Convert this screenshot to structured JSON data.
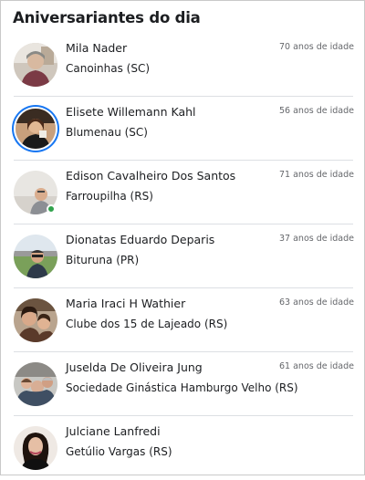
{
  "title": "Aniversariantes do dia",
  "colors": {
    "accent_ring": "#1877f2",
    "online": "#31a24c",
    "divider": "#dcdfe3",
    "muted": "#65676b"
  },
  "people": [
    {
      "name": "Mila Nader",
      "city": "Canoinhas (SC)",
      "age": "70 anos de idade",
      "avatar_icon": "avatar-photo",
      "story_ring": false,
      "online": false
    },
    {
      "name": "Elisete Willemann Kahl",
      "city": "Blumenau (SC)",
      "age": "56 anos de idade",
      "avatar_icon": "avatar-photo",
      "story_ring": true,
      "online": false
    },
    {
      "name": "Edison Cavalheiro Dos Santos",
      "city": "Farroupilha (RS)",
      "age": "71 anos de idade",
      "avatar_icon": "avatar-photo",
      "story_ring": false,
      "online": true
    },
    {
      "name": "Dionatas Eduardo Deparis",
      "city": "Bituruna (PR)",
      "age": "37 anos de idade",
      "avatar_icon": "avatar-photo",
      "story_ring": false,
      "online": false
    },
    {
      "name": "Maria Iraci H Wathier",
      "city": "Clube dos 15 de Lajeado (RS)",
      "age": "63 anos de idade",
      "avatar_icon": "avatar-photo",
      "story_ring": false,
      "online": false
    },
    {
      "name": "Juselda De Oliveira Jung",
      "city": "Sociedade Ginástica Hamburgo Velho (RS)",
      "age": "61 anos de idade",
      "avatar_icon": "avatar-photo",
      "story_ring": false,
      "online": false
    },
    {
      "name": "Julciane Lanfredi",
      "city": "Getúlio Vargas (RS)",
      "age": "",
      "avatar_icon": "avatar-photo",
      "story_ring": false,
      "online": false
    }
  ]
}
